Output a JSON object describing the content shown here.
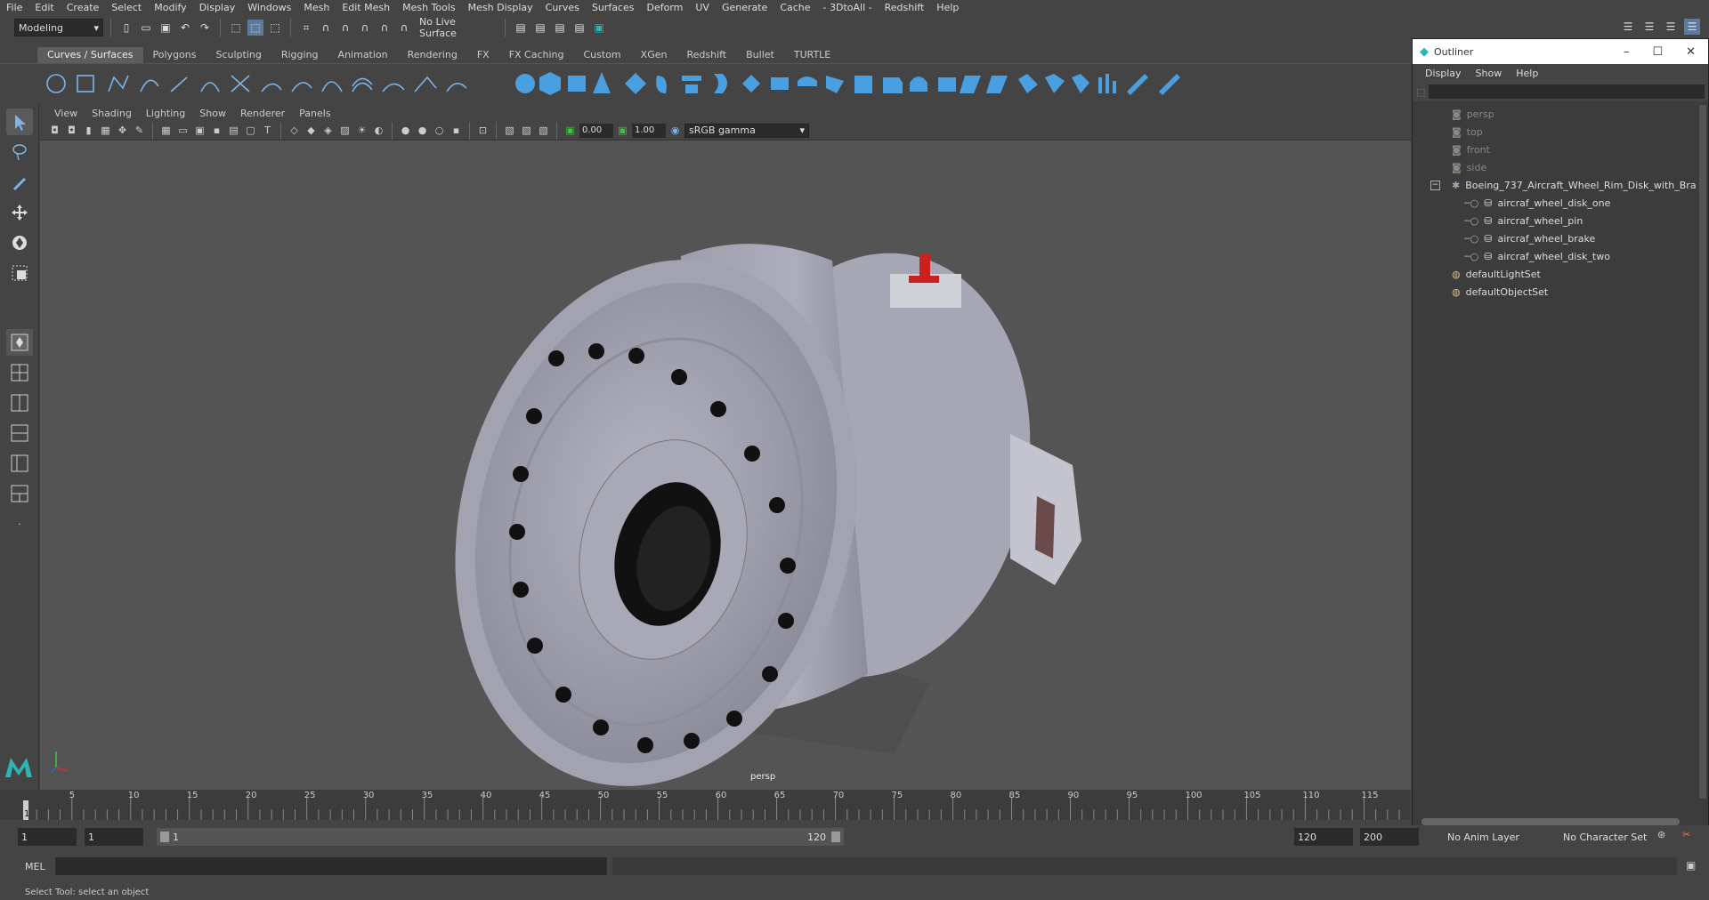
{
  "menu": [
    "File",
    "Edit",
    "Create",
    "Select",
    "Modify",
    "Display",
    "Windows",
    "Mesh",
    "Edit Mesh",
    "Mesh Tools",
    "Mesh Display",
    "Curves",
    "Surfaces",
    "Deform",
    "UV",
    "Generate",
    "Cache",
    "- 3DtoAll -",
    "Redshift",
    "Help"
  ],
  "status": {
    "mode": "Modeling",
    "live_surface": "No Live Surface"
  },
  "shelf_tabs": [
    "Curves / Surfaces",
    "Polygons",
    "Sculpting",
    "Rigging",
    "Animation",
    "Rendering",
    "FX",
    "FX Caching",
    "Custom",
    "XGen",
    "Redshift",
    "Bullet",
    "TURTLE"
  ],
  "shelf_active": "Curves / Surfaces",
  "panel_menu": [
    "View",
    "Shading",
    "Lighting",
    "Show",
    "Renderer",
    "Panels"
  ],
  "panel_fields": {
    "exposure": "0.00",
    "gamma": "1.00",
    "color_space": "sRGB gamma"
  },
  "viewport": {
    "camera": "persp"
  },
  "outliner": {
    "title": "Outliner",
    "menu": [
      "Display",
      "Show",
      "Help"
    ],
    "cameras": [
      "persp",
      "top",
      "front",
      "side"
    ],
    "group": "Boeing_737_Aircraft_Wheel_Rim_Disk_with_Bra",
    "children": [
      "aircraf_wheel_disk_one",
      "aircraf_wheel_pin",
      "aircraf_wheel_brake",
      "aircraf_wheel_disk_two"
    ],
    "sets": [
      "defaultLightSet",
      "defaultObjectSet"
    ]
  },
  "timeline": {
    "ticks": [
      "1",
      "5",
      "10",
      "15",
      "20",
      "25",
      "30",
      "35",
      "40",
      "45",
      "50",
      "55",
      "60",
      "65",
      "70",
      "75",
      "80",
      "85",
      "90",
      "95",
      "100",
      "105",
      "110",
      "115"
    ],
    "current_frame": "1"
  },
  "range": {
    "start": "1",
    "playback_start": "1",
    "slider_start": "1",
    "slider_end": "120",
    "playback_end": "120",
    "end": "200",
    "anim_layer": "No Anim Layer",
    "character_set": "No Character Set"
  },
  "cmd": {
    "label": "MEL"
  },
  "help": "Select Tool: select an object",
  "colors": {
    "ui_bg": "#444444",
    "viewport_bg": "#545454",
    "wheel": "#9a9aa8",
    "accent_teal": "#2fb4b4",
    "accent_red": "#cc1f1f"
  }
}
